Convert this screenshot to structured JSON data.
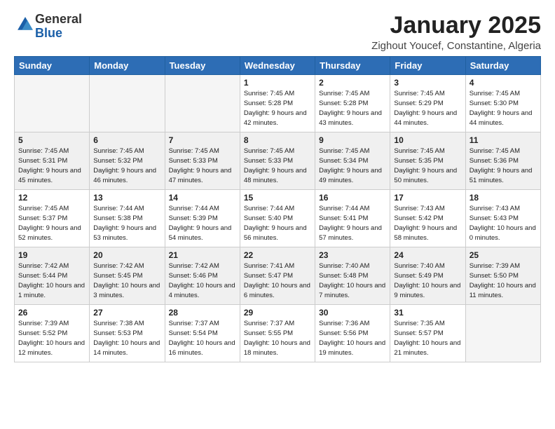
{
  "logo": {
    "general": "General",
    "blue": "Blue"
  },
  "title": "January 2025",
  "subtitle": "Zighout Youcef, Constantine, Algeria",
  "weekdays": [
    "Sunday",
    "Monday",
    "Tuesday",
    "Wednesday",
    "Thursday",
    "Friday",
    "Saturday"
  ],
  "weeks": [
    [
      {
        "day": "",
        "empty": true
      },
      {
        "day": "",
        "empty": true
      },
      {
        "day": "",
        "empty": true
      },
      {
        "day": "1",
        "sunrise": "7:45 AM",
        "sunset": "5:28 PM",
        "daylight": "9 hours and 42 minutes."
      },
      {
        "day": "2",
        "sunrise": "7:45 AM",
        "sunset": "5:28 PM",
        "daylight": "9 hours and 43 minutes."
      },
      {
        "day": "3",
        "sunrise": "7:45 AM",
        "sunset": "5:29 PM",
        "daylight": "9 hours and 44 minutes."
      },
      {
        "day": "4",
        "sunrise": "7:45 AM",
        "sunset": "5:30 PM",
        "daylight": "9 hours and 44 minutes."
      }
    ],
    [
      {
        "day": "5",
        "sunrise": "7:45 AM",
        "sunset": "5:31 PM",
        "daylight": "9 hours and 45 minutes."
      },
      {
        "day": "6",
        "sunrise": "7:45 AM",
        "sunset": "5:32 PM",
        "daylight": "9 hours and 46 minutes."
      },
      {
        "day": "7",
        "sunrise": "7:45 AM",
        "sunset": "5:33 PM",
        "daylight": "9 hours and 47 minutes."
      },
      {
        "day": "8",
        "sunrise": "7:45 AM",
        "sunset": "5:33 PM",
        "daylight": "9 hours and 48 minutes."
      },
      {
        "day": "9",
        "sunrise": "7:45 AM",
        "sunset": "5:34 PM",
        "daylight": "9 hours and 49 minutes."
      },
      {
        "day": "10",
        "sunrise": "7:45 AM",
        "sunset": "5:35 PM",
        "daylight": "9 hours and 50 minutes."
      },
      {
        "day": "11",
        "sunrise": "7:45 AM",
        "sunset": "5:36 PM",
        "daylight": "9 hours and 51 minutes."
      }
    ],
    [
      {
        "day": "12",
        "sunrise": "7:45 AM",
        "sunset": "5:37 PM",
        "daylight": "9 hours and 52 minutes."
      },
      {
        "day": "13",
        "sunrise": "7:44 AM",
        "sunset": "5:38 PM",
        "daylight": "9 hours and 53 minutes."
      },
      {
        "day": "14",
        "sunrise": "7:44 AM",
        "sunset": "5:39 PM",
        "daylight": "9 hours and 54 minutes."
      },
      {
        "day": "15",
        "sunrise": "7:44 AM",
        "sunset": "5:40 PM",
        "daylight": "9 hours and 56 minutes."
      },
      {
        "day": "16",
        "sunrise": "7:44 AM",
        "sunset": "5:41 PM",
        "daylight": "9 hours and 57 minutes."
      },
      {
        "day": "17",
        "sunrise": "7:43 AM",
        "sunset": "5:42 PM",
        "daylight": "9 hours and 58 minutes."
      },
      {
        "day": "18",
        "sunrise": "7:43 AM",
        "sunset": "5:43 PM",
        "daylight": "10 hours and 0 minutes."
      }
    ],
    [
      {
        "day": "19",
        "sunrise": "7:42 AM",
        "sunset": "5:44 PM",
        "daylight": "10 hours and 1 minute."
      },
      {
        "day": "20",
        "sunrise": "7:42 AM",
        "sunset": "5:45 PM",
        "daylight": "10 hours and 3 minutes."
      },
      {
        "day": "21",
        "sunrise": "7:42 AM",
        "sunset": "5:46 PM",
        "daylight": "10 hours and 4 minutes."
      },
      {
        "day": "22",
        "sunrise": "7:41 AM",
        "sunset": "5:47 PM",
        "daylight": "10 hours and 6 minutes."
      },
      {
        "day": "23",
        "sunrise": "7:40 AM",
        "sunset": "5:48 PM",
        "daylight": "10 hours and 7 minutes."
      },
      {
        "day": "24",
        "sunrise": "7:40 AM",
        "sunset": "5:49 PM",
        "daylight": "10 hours and 9 minutes."
      },
      {
        "day": "25",
        "sunrise": "7:39 AM",
        "sunset": "5:50 PM",
        "daylight": "10 hours and 11 minutes."
      }
    ],
    [
      {
        "day": "26",
        "sunrise": "7:39 AM",
        "sunset": "5:52 PM",
        "daylight": "10 hours and 12 minutes."
      },
      {
        "day": "27",
        "sunrise": "7:38 AM",
        "sunset": "5:53 PM",
        "daylight": "10 hours and 14 minutes."
      },
      {
        "day": "28",
        "sunrise": "7:37 AM",
        "sunset": "5:54 PM",
        "daylight": "10 hours and 16 minutes."
      },
      {
        "day": "29",
        "sunrise": "7:37 AM",
        "sunset": "5:55 PM",
        "daylight": "10 hours and 18 minutes."
      },
      {
        "day": "30",
        "sunrise": "7:36 AM",
        "sunset": "5:56 PM",
        "daylight": "10 hours and 19 minutes."
      },
      {
        "day": "31",
        "sunrise": "7:35 AM",
        "sunset": "5:57 PM",
        "daylight": "10 hours and 21 minutes."
      },
      {
        "day": "",
        "empty": true
      }
    ]
  ]
}
